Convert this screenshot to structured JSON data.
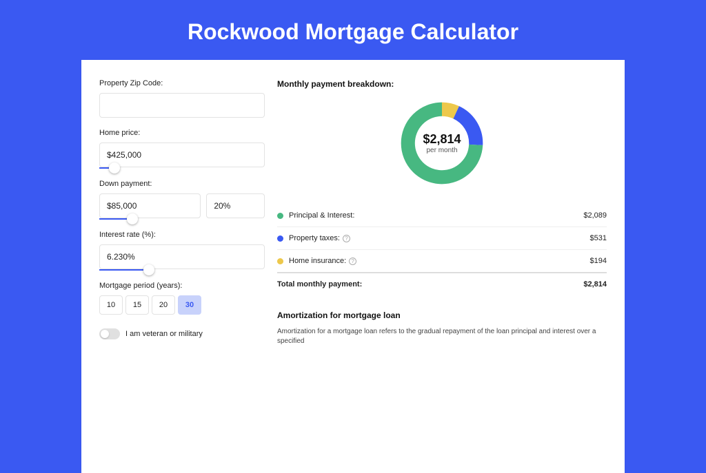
{
  "title": "Rockwood Mortgage Calculator",
  "form": {
    "zip_label": "Property Zip Code:",
    "zip_value": "",
    "home_price_label": "Home price:",
    "home_price_value": "$425,000",
    "home_price_slider_pct": 9,
    "down_payment_label": "Down payment:",
    "down_payment_value": "$85,000",
    "down_payment_pct_value": "20%",
    "down_payment_slider_pct": 20,
    "interest_label": "Interest rate (%):",
    "interest_value": "6.230%",
    "interest_slider_pct": 30,
    "period_label": "Mortgage period (years):",
    "periods": [
      "10",
      "15",
      "20",
      "30"
    ],
    "period_active": "30",
    "veteran_label": "I am veteran or military"
  },
  "breakdown": {
    "title": "Monthly payment breakdown:",
    "center_amount": "$2,814",
    "center_sub": "per month",
    "items": [
      {
        "label": "Principal & Interest:",
        "value": "$2,089",
        "color": "green",
        "info": false,
        "num": 2089
      },
      {
        "label": "Property taxes:",
        "value": "$531",
        "color": "blue",
        "info": true,
        "num": 531
      },
      {
        "label": "Home insurance:",
        "value": "$194",
        "color": "gold",
        "info": true,
        "num": 194
      }
    ],
    "total_label": "Total monthly payment:",
    "total_value": "$2,814"
  },
  "amort": {
    "title": "Amortization for mortgage loan",
    "text": "Amortization for a mortgage loan refers to the gradual repayment of the loan principal and interest over a specified"
  },
  "colors": {
    "green": "#47b881",
    "blue": "#3a59f2",
    "gold": "#edc84b"
  },
  "chart_data": {
    "type": "pie",
    "title": "Monthly payment breakdown:",
    "categories": [
      "Principal & Interest",
      "Property taxes",
      "Home insurance"
    ],
    "values": [
      2089,
      531,
      194
    ],
    "total": 2814
  }
}
